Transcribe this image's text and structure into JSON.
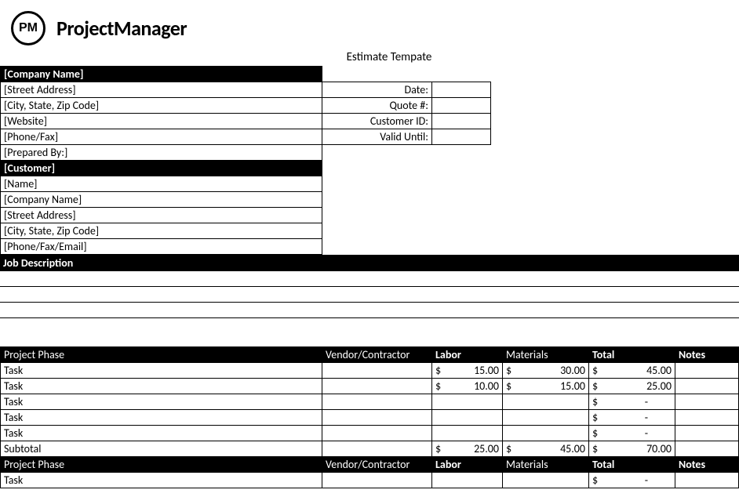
{
  "brand": "ProjectManager",
  "logo_text": "PM",
  "doc_title": "Estimate Tempate",
  "company_section": {
    "header": "[Company Name]",
    "street": "[Street Address]",
    "city": "[City, State, Zip Code]",
    "website": "[Website]",
    "phone": "[Phone/Fax]",
    "prepared_by": "[Prepared By:]"
  },
  "meta": {
    "date_label": "Date:",
    "quote_label": "Quote #:",
    "customer_id_label": "Customer ID:",
    "valid_until_label": "Valid Until:",
    "date_value": "",
    "quote_value": "",
    "customer_id_value": "",
    "valid_until_value": ""
  },
  "customer_section": {
    "header": "[Customer]",
    "name": "[Name]",
    "company": "[Company Name]",
    "street": "[Street Address]",
    "city": "[City, State, Zip Code]",
    "phone": "[Phone/Fax/Email]"
  },
  "job_description_header": "Job Description",
  "columns": {
    "phase": "Project Phase",
    "vendor": "Vendor/Contractor",
    "labor": "Labor",
    "materials": "Materials",
    "total": "Total",
    "notes": "Notes"
  },
  "currency": "$",
  "dash": "-",
  "phase1": {
    "rows": [
      {
        "task": "Task",
        "vendor": "",
        "labor": "15.00",
        "materials": "30.00",
        "total": "45.00",
        "notes": ""
      },
      {
        "task": "Task",
        "vendor": "",
        "labor": "10.00",
        "materials": "15.00",
        "total": "25.00",
        "notes": ""
      },
      {
        "task": "Task",
        "vendor": "",
        "labor": "",
        "materials": "",
        "total": "-",
        "notes": ""
      },
      {
        "task": "Task",
        "vendor": "",
        "labor": "",
        "materials": "",
        "total": "-",
        "notes": ""
      },
      {
        "task": "Task",
        "vendor": "",
        "labor": "",
        "materials": "",
        "total": "-",
        "notes": ""
      }
    ],
    "subtotal_label": "Subtotal",
    "subtotal": {
      "labor": "25.00",
      "materials": "45.00",
      "total": "70.00"
    }
  },
  "phase2": {
    "rows": [
      {
        "task": "Task",
        "vendor": "",
        "labor": "",
        "materials": "",
        "total": "-",
        "notes": ""
      }
    ]
  }
}
